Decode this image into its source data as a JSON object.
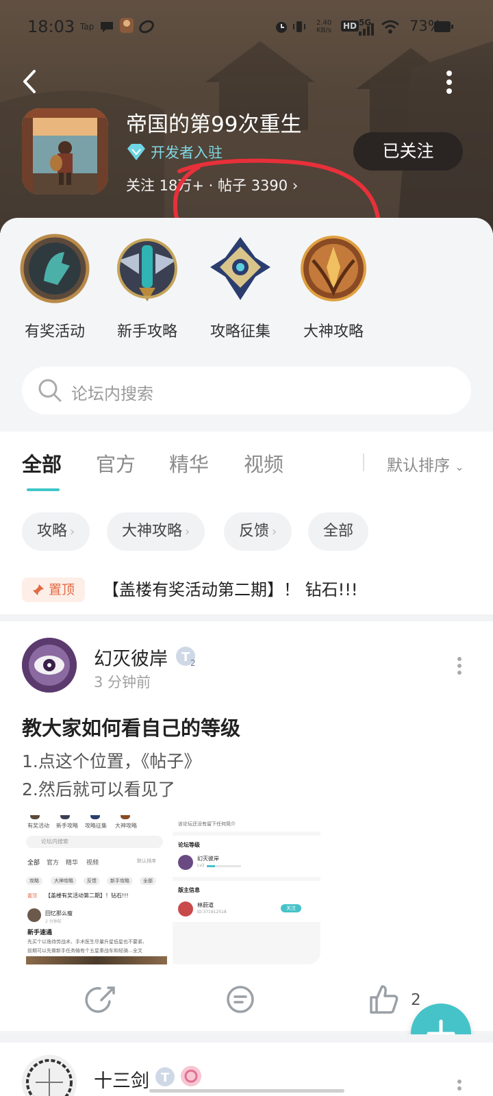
{
  "status_bar": {
    "time": "18:03",
    "tap": "Tap",
    "speed_value": "2.40",
    "speed_unit": "KB/s",
    "hd": "HD",
    "network": "5G",
    "battery_pct": "73%"
  },
  "header": {
    "game_title": "帝国的第99次重生",
    "dev_badge": "开发者入驻",
    "stats": "关注 18万+ · 帖子 3390",
    "follow_label": "已关注"
  },
  "quick_links": [
    {
      "label": "有奖活动"
    },
    {
      "label": "新手攻略"
    },
    {
      "label": "攻略征集"
    },
    {
      "label": "大神攻略"
    }
  ],
  "search": {
    "placeholder": "论坛内搜索"
  },
  "tabs": [
    {
      "label": "全部"
    },
    {
      "label": "官方"
    },
    {
      "label": "精华"
    },
    {
      "label": "视频"
    }
  ],
  "sort_label": "默认排序",
  "chips": [
    {
      "label": "攻略"
    },
    {
      "label": "大神攻略"
    },
    {
      "label": "反馈"
    },
    {
      "label": "全部"
    }
  ],
  "pinned": {
    "tag": "置顶",
    "title": "【盖楼有奖活动第二期】！ 钻石!!!"
  },
  "post": {
    "author": "幻灭彼岸",
    "time_ago": "3 分钟前",
    "title": "教大家如何看自己的等级",
    "lines": [
      "1.点这个位置，《帖子》",
      "2.然后就可以看见了"
    ],
    "like_count": "2"
  },
  "thumb_left": {
    "q1": "有奖活动",
    "q2": "新手攻略",
    "q3": "攻略征集",
    "q4": "大神攻略",
    "search": "论坛内搜索",
    "t1": "全部",
    "t2": "官方",
    "t3": "精华",
    "t4": "视频",
    "sort": "默认排序",
    "c1": "攻略",
    "c2": "大神攻略",
    "c3": "反馈",
    "c4": "新手攻略",
    "c5": "全部",
    "pin": "置顶",
    "pin_title": "【盖楼有奖活动第二期】！钻石!!!",
    "author": "回忆那么瘦",
    "time": "2 分钟前",
    "title": "新手速通",
    "body1": "先买个以逸待劳战术、手术医生尽量升星低星也不要紧、",
    "body2": "前期可以先做新手任务输有个五星秦战车和轻骑…全文"
  },
  "thumb_right": {
    "intro": "该论坛还没有留下任何简介",
    "level_title": "论坛等级",
    "user": "幻灭彼岸",
    "lv": "Lv2",
    "mod_title": "版主信息",
    "mod_name": "林蔚道",
    "mod_id": "ID:371912518",
    "follow": "关注"
  },
  "post2": {
    "author": "十三剑"
  },
  "colors": {
    "accent": "#45c3c8",
    "pin": "#e26a43",
    "annotation": "#e8303a"
  }
}
